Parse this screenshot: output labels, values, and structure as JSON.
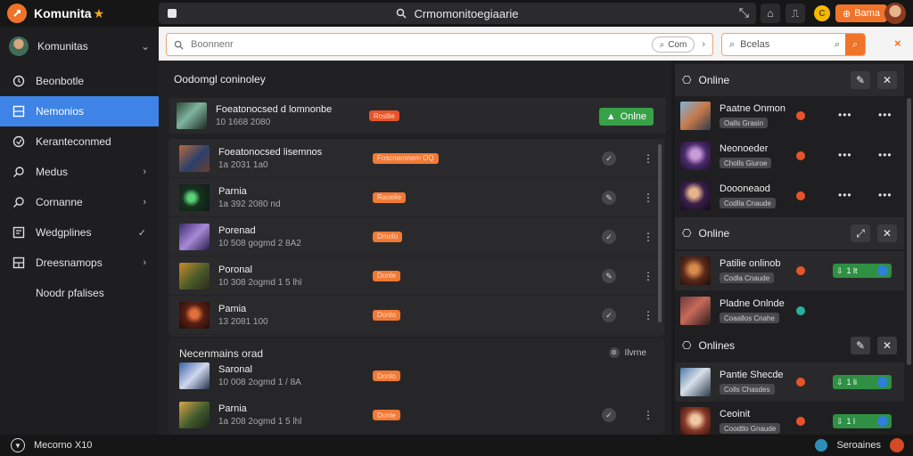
{
  "app": {
    "name": "Komunita",
    "search_text": "Crmomonitoegiaarie",
    "coin_label": "C",
    "top_pill_label": "Bama"
  },
  "sidebar": {
    "header_label": "Komunitas",
    "items": [
      {
        "label": "Beonbotle",
        "icon": "circle-icon",
        "chevron": ""
      },
      {
        "label": "Nemonios",
        "icon": "grid-icon",
        "chevron": ""
      },
      {
        "label": "Keranteconmed",
        "icon": "clock-icon",
        "chevron": ""
      },
      {
        "label": "Medus",
        "icon": "search-icon",
        "chevron": "›"
      },
      {
        "label": "Cornanne",
        "icon": "search-icon",
        "chevron": "›"
      },
      {
        "label": "Wedgplines",
        "icon": "list-icon",
        "chevron": "✓"
      },
      {
        "label": "Dreesnamops",
        "icon": "grid-icon",
        "chevron": "›"
      },
      {
        "label": "Noodr pfalises",
        "icon": "",
        "chevron": ""
      }
    ]
  },
  "filter": {
    "placeholder": "Boonnenr",
    "chip_label": "Com",
    "right_label": "Bcelas",
    "close_label": "×"
  },
  "main": {
    "title": "Oodomgl coninoley",
    "featured": {
      "title": "Foeatonocsed d lomnonbe",
      "sub": "10 1668 2080",
      "tag": "Rosllie",
      "online_label": "Onlne"
    },
    "rows": [
      {
        "title": "Foeatonocsed lisemnos",
        "sub": "1a 2031 1a0",
        "tag": "Foscnaronem OQ"
      },
      {
        "title": "Parnia",
        "sub": "1a 392 2080 nd",
        "tag": "Raoelie"
      },
      {
        "title": "Porenad",
        "sub": "10 508 gogmd 2 8A2",
        "tag": "Dmnlo"
      },
      {
        "title": "Poronal",
        "sub": "10 308 2ogmd 1 5 lhl",
        "tag": "Donle"
      },
      {
        "title": "Pamia",
        "sub": "13 2081 100",
        "tag": "Donlo"
      }
    ],
    "section2": {
      "title": "Necenmains orad",
      "right_label": "Ilvrne",
      "rows": [
        {
          "title": "Saronal",
          "sub": "10 008 2ogmd 1 / 8A",
          "tag": "Donlo"
        },
        {
          "title": "Parnia",
          "sub": "1a 208 2ogmd 1 5 lhl",
          "tag": "Donle"
        }
      ]
    }
  },
  "right_panel": {
    "groups": [
      {
        "title": "Online",
        "players": [
          {
            "name": "Paatne Onmon",
            "status": "Oalls Grasin"
          },
          {
            "name": "Neonoeder",
            "status": "Cholls Giuroe"
          },
          {
            "name": "Doooneaod",
            "status": "Codlla Cnaude"
          }
        ]
      },
      {
        "title": "Online",
        "players": [
          {
            "name": "Patilie onlinob",
            "status": "Codla Cnaude",
            "badge": "1 lt"
          },
          {
            "name": "Pladne Onlnde",
            "status": "Coaallos Cnahe",
            "badge": ""
          }
        ]
      },
      {
        "title": "Onlines",
        "players": [
          {
            "name": "Pantie Shecde",
            "status": "Colls Chasdes",
            "badge": "1 li"
          },
          {
            "name": "Ceoinit",
            "status": "Coodtlo Gnaude",
            "badge": "1 l"
          }
        ]
      }
    ]
  },
  "bottom": {
    "left_label": "Mecorno X10",
    "right_label": "Seroaines"
  }
}
